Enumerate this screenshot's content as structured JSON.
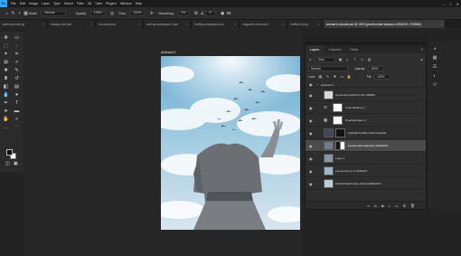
{
  "app": {
    "logo": "Ps"
  },
  "menu": [
    "File",
    "Edit",
    "Image",
    "Layer",
    "Type",
    "Select",
    "Filter",
    "3D",
    "View",
    "Plugins",
    "Window",
    "Help"
  ],
  "options": {
    "mode_label": "Mode:",
    "mode_value": "Normal",
    "opacity_label": "Opacity:",
    "opacity_value": "100%",
    "flow_label": "Flow:",
    "flow_value": "100%",
    "smoothing_label": "Smoothing:",
    "smoothing_value": "0%",
    "angle_value": "0°"
  },
  "tabs": [
    {
      "label": "weird-cat-cute.gif",
      "active": false
    },
    {
      "label": "ludwlgc-surf.psd",
      "active": false
    },
    {
      "label": "luv-wave.psd",
      "active": false
    },
    {
      "label": "surfing-newspaper-2.psd",
      "active": false
    },
    {
      "label": "Surfing-newspaper.psd",
      "active": false
    },
    {
      "label": "magazine-cover.psd",
      "active": false
    },
    {
      "label": "Untitled-2.png",
      "active": false
    },
    {
      "label": "woman-in-clouds.psd @ 100% (pexels-ester-kapusco-14944201, RGB/8#)",
      "active": true
    }
  ],
  "artboard": {
    "label": "Artboard 1"
  },
  "layers_panel": {
    "tabs": [
      "Layers",
      "Channels",
      "Paths"
    ],
    "filter_kind": "Kind",
    "blend_mode": "Normal",
    "opacity_label": "Opacity:",
    "opacity_value": "100%",
    "lock_label": "Lock:",
    "fill_label": "Fill:",
    "fill_value": "100%",
    "group_name": "Artboard 1",
    "layers": [
      {
        "name": "Screenshot 2023-07-16 135859",
        "selected": false,
        "has_mask": false
      },
      {
        "name": "Color Balance 1",
        "selected": false,
        "has_mask": true
      },
      {
        "name": "Hue/Saturation 1",
        "selected": false,
        "has_mask": true
      },
      {
        "name": "bdc6ddc0-f2f60-44b2-b2e2a52",
        "selected": false,
        "has_mask": true
      },
      {
        "name": "pexels-ester-kapusco-14944201",
        "selected": true,
        "has_mask": true
      },
      {
        "name": "Layer 1",
        "selected": false,
        "has_mask": false
      },
      {
        "name": "pexels-lucy-4-cc-2994227",
        "selected": false,
        "has_mask": false
      },
      {
        "name": "f2cb0b7d1a0-e9ee-4ebb-b4bfbfe97d",
        "selected": false,
        "has_mask": false
      }
    ]
  },
  "colors": {
    "accent": "#31a8ff",
    "foreground": "#0a0a0a",
    "background": "#ffffff"
  }
}
